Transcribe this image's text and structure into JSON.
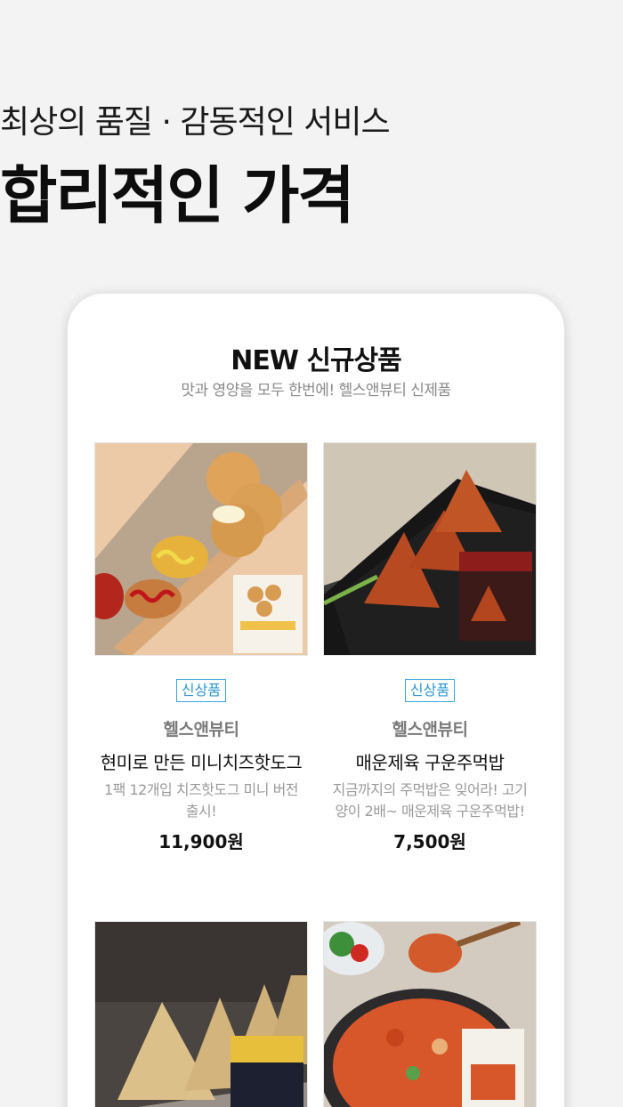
{
  "hero": {
    "subtitle": "최상의 품질 · 감동적인 서비스",
    "title": "합리적인 가격"
  },
  "section": {
    "title": "NEW 신규상품",
    "subtitle": "맛과 영양을 모두 한번에! 헬스앤뷰티 신제품"
  },
  "products": [
    {
      "badge": "신상품",
      "brand": "헬스앤뷰티",
      "name": "현미로 만든 미니치즈핫도그",
      "description": "1팩 12개입 치즈핫도그 미니 버전 출시!",
      "price": "11,900원"
    },
    {
      "badge": "신상품",
      "brand": "헬스앤뷰티",
      "name": "매운제육 구운주먹밥",
      "description": "지금까지의 주먹밥은 잊어라! 고기양이 2배~ 매운제육 구운주먹밥!",
      "price": "7,500원"
    }
  ],
  "colors": {
    "background": "#f3f3f3",
    "card": "#ffffff",
    "badge": "#2a96d2",
    "muted_text": "#8a8a8a"
  }
}
